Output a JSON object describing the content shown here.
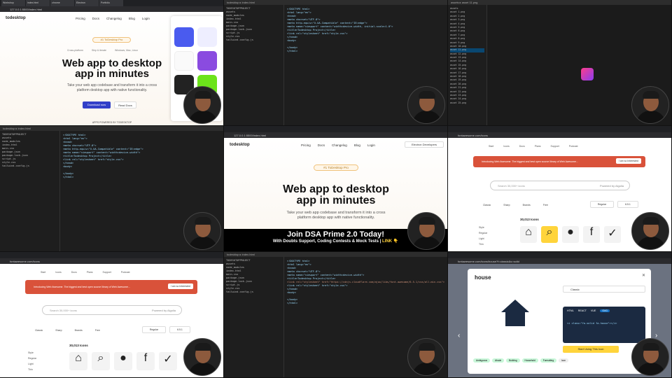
{
  "tile1": {
    "tabs": [
      "Workshop",
      "index.html",
      "chrome",
      "Electron",
      "Portfolio"
    ],
    "address": "127.0.0.1:5500/index.html",
    "logo": "todesktop",
    "nav": [
      "Pricing",
      "Docs",
      "Changelog",
      "Blog",
      "Login"
    ],
    "badge": "#1 ToDesktop Pro",
    "features": [
      "Cross-platform",
      "Ship & iterate",
      "Windows, Mac, Linux"
    ],
    "headline_1": "Web app to desktop",
    "headline_2": "app in minutes",
    "subtitle": "Take your web app codebase and transform it into a cross platform desktop app with native functionality.",
    "primary_button": "Download now",
    "secondary_button": "Read Docs",
    "footer_note": "APPS POWERED BY TODESKTOP"
  },
  "tile2": {
    "title_bar": "todesktop ▸ index.html",
    "files": [
      "TODESKTOPPROJECT",
      "assets",
      "node_modules",
      "index.html",
      "main.css",
      "package.json",
      "package-lock.json",
      "script.js",
      "style.css",
      "tailwind.config.js"
    ],
    "code": [
      "<!DOCTYPE html>",
      "<html lang=\"en\">",
      "<head>",
      "  <meta charset=\"UTF-8\">",
      "  <meta http-equiv=\"X-UA-Compatible\" content=\"IE=edge\">",
      "  <meta name=\"viewport\" content=\"width=device-width, initial-scale=1.0\">",
      "  <title>Todesktop Project</title>",
      "  <link rel=\"stylesheet\" href=\"style.css\">",
      "</head>",
      "<body>",
      "",
      "</body>",
      "</html>"
    ]
  },
  "tile3": {
    "title_bar": "assets ▸ asset 11.png",
    "files": [
      "assets",
      "asset 1.png",
      "asset 2.png",
      "asset 3.png",
      "asset 4.png",
      "asset 5.png",
      "asset 6.png",
      "asset 7.png",
      "asset 8.png",
      "asset 9.png",
      "asset 10.png",
      "asset 11.png",
      "asset 12.png",
      "asset 13.png",
      "asset 14.png",
      "asset 15.png",
      "asset 16.png",
      "asset 17.png",
      "asset 18.png",
      "asset 19.png",
      "asset 20.png",
      "asset 21.png",
      "asset 22.png",
      "asset 23.png",
      "asset 24.png",
      "asset 25.png"
    ]
  },
  "tile4": {
    "title_bar": "todesktop ▸ index.html",
    "files": [
      "TODESKTOPPROJECT",
      "assets",
      "node_modules",
      "index.html",
      "main.css",
      "package.json",
      "package-lock.json",
      "script.js",
      "style.css",
      "tailwind.config.js"
    ],
    "code": [
      "<!DOCTYPE html>",
      "<html lang=\"en\">",
      "<head>",
      "  <meta charset=\"UTF-8\">",
      "  <meta http-equiv=\"X-UA-Compatible\" content=\"IE=edge\">",
      "  <meta name=\"viewport\" content=\"width=device-width\">",
      "  <title>Todesktop Project</title>",
      "  <link rel=\"stylesheet\" href=\"style.css\">",
      "</head>",
      "<body>",
      "",
      "</body>",
      "</html>"
    ]
  },
  "tile5": {
    "address": "127.0.0.1:5500/index.html",
    "logo": "todesktop",
    "nav": [
      "Pricing",
      "Docs",
      "Changelog",
      "Blog",
      "Login"
    ],
    "electron_button": "Electron Developers",
    "badge": "#1 ToDesktop Pro",
    "headline_1": "Web app to desktop",
    "headline_2": "app in minutes",
    "subtitle": "Take your web app codebase and transform it into a cross platform desktop app with native functionality.",
    "promo_title": "Join DSA Prime 2.0 Today!",
    "promo_sub": "With Doubts Support, Coding Contests & Mock Tests | ",
    "promo_link": "LINK 👇"
  },
  "tile6": {
    "address": "fontawesome.com/icons",
    "nav": [
      "Start",
      "Icons",
      "Docs",
      "Plans",
      "Support",
      "Podcast"
    ],
    "banner_text": "Introducing Web Awesome. The biggest and best open source library of Web Awesome...",
    "banner_button": "I am so Interested",
    "search_placeholder": "Search 30,000+ icons",
    "powered": "Powered by Algolia",
    "count": "30,013 Icons",
    "filters": [
      "Classic",
      "Sharp",
      "Brands",
      "Free"
    ],
    "style_select": "Regular",
    "version_select": "6.5.1",
    "categories": [
      "Style",
      "Regular",
      "Light",
      "Thin"
    ]
  },
  "tile7": {
    "address": "fontawesome.com/icons",
    "nav": [
      "Start",
      "Icons",
      "Docs",
      "Plans",
      "Support",
      "Podcast"
    ],
    "banner_text": "Introducing Web Awesome. The biggest and best open source library of Web Awesome...",
    "banner_button": "I am so Interested",
    "search_placeholder": "Search 30,000+ icons",
    "powered": "Powered by Algolia",
    "count": "30,013 Icons",
    "filters": [
      "Classic",
      "Sharp",
      "Brands",
      "Free"
    ],
    "style_select": "Regular",
    "version_select": "6.5.1",
    "categories": [
      "Style",
      "Regular",
      "Light",
      "Thin"
    ]
  },
  "tile8": {
    "title_bar": "todesktop ▸ index.html",
    "files": [
      "TODESKTOPPROJECT",
      "assets",
      "node_modules",
      "index.html",
      "main.css",
      "package.json",
      "package-lock.json",
      "script.js",
      "style.css",
      "tailwind.config.js"
    ],
    "code": [
      "<!DOCTYPE html>",
      "<html lang=\"en\">",
      "<head>",
      "  <meta charset=\"UTF-8\">",
      "  <meta name=\"viewport\" content=\"width=device-width\">",
      "  <title>Todesktop Project</title>",
      "  <link rel=\"stylesheet\" href=\"https://cdnjs.cloudflare.com/ajax/libs/font-awesome/6.5.1/css/all.min.css\">",
      "  <link rel=\"stylesheet\" href=\"style.css\">",
      "</head>",
      "<body>",
      "",
      "</body>",
      "</html>"
    ]
  },
  "tile9": {
    "address": "fontawesome.com/icons/house?f=classic&s=solid",
    "icon_name": "house",
    "style_select": "Classic",
    "code_tabs": [
      "HTML",
      "REACT",
      "VUE",
      "SVG"
    ],
    "code_snippet": "<i class=\"fa-solid fa-house\"></i>",
    "start_button": "Start Using This Icon",
    "tags": [
      "Ambiguous",
      "Abode",
      "Building",
      "Household",
      "Formatting",
      "Icon"
    ]
  },
  "colors": {
    "vscode_bg": "#1e1e1e",
    "accent_blue": "#3140c8",
    "banner_red": "#d9523a",
    "fa_blue": "#146ebe"
  }
}
